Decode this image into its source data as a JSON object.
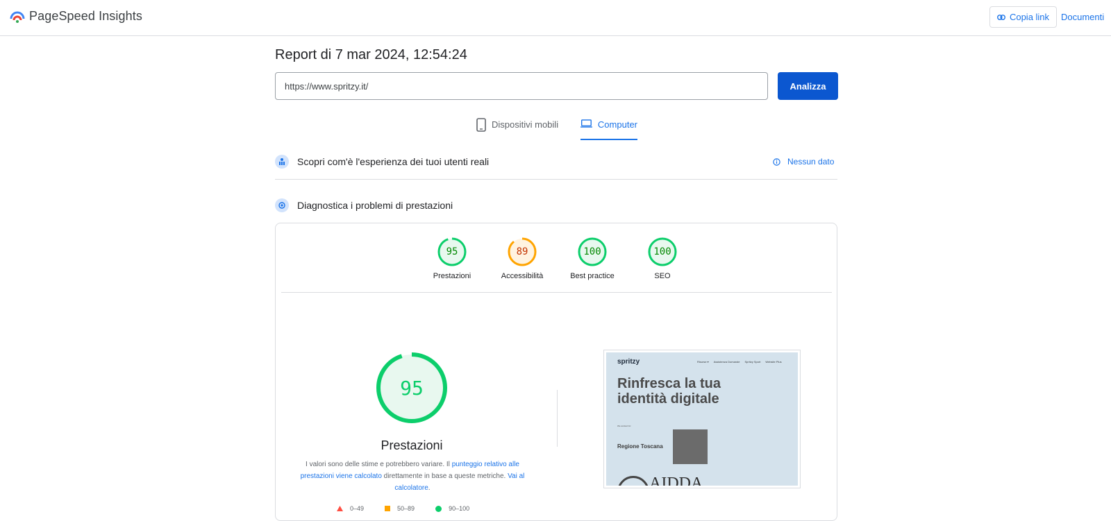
{
  "app": {
    "brand": "PageSpeed Insights"
  },
  "header": {
    "copy_link": "Copia link",
    "docs": "Documenti"
  },
  "report": {
    "title": "Report di 7 mar 2024, 12:54:24",
    "url": "https://www.spritzy.it/",
    "analyze": "Analizza"
  },
  "tabs": [
    {
      "label": "Dispositivi mobili",
      "active": false
    },
    {
      "label": "Computer",
      "active": true
    }
  ],
  "field_data": {
    "label": "Scopri com'è l'esperienza dei tuoi utenti reali",
    "status": "Nessun dato"
  },
  "diagnose": {
    "label": "Diagnostica i problemi di prestazioni"
  },
  "scores": [
    {
      "label": "Prestazioni",
      "value": "95",
      "color": "#0cce6b"
    },
    {
      "label": "Accessibilità",
      "value": "89",
      "color": "#ffa400"
    },
    {
      "label": "Best practice",
      "value": "100",
      "color": "#0cce6b"
    },
    {
      "label": "SEO",
      "value": "100",
      "color": "#0cce6b"
    }
  ],
  "performance": {
    "score": "95",
    "label": "Prestazioni",
    "desc_1": "I valori sono delle stime e potrebbero variare. Il ",
    "desc_link_1": "punteggio relativo alle prestazioni viene calcolato",
    "desc_2": " direttamente in base a queste metriche. ",
    "desc_link_2": "Vai al calcolatore",
    "desc_3": "."
  },
  "legend": [
    {
      "range": "0–49",
      "color": "#ff4e42"
    },
    {
      "range": "50–89",
      "color": "#ffa400"
    },
    {
      "range": "90–100",
      "color": "#0cce6b"
    }
  ],
  "screenshot": {
    "logo": "spritzy",
    "nav": [
      "Risorse ▾",
      "Assistenza Domande",
      "Spritzy Sport",
      "Website Plus"
    ],
    "headline": "Rinfresca la tua identità digitale",
    "small": "We worked for:",
    "client": "Regione Toscana",
    "bottom": "AIDDA"
  },
  "colors": {
    "accent": "#1a73e8",
    "button": "#0b57d0",
    "pass": "#0cce6b",
    "average": "#ffa400",
    "fail": "#ff4e42"
  }
}
